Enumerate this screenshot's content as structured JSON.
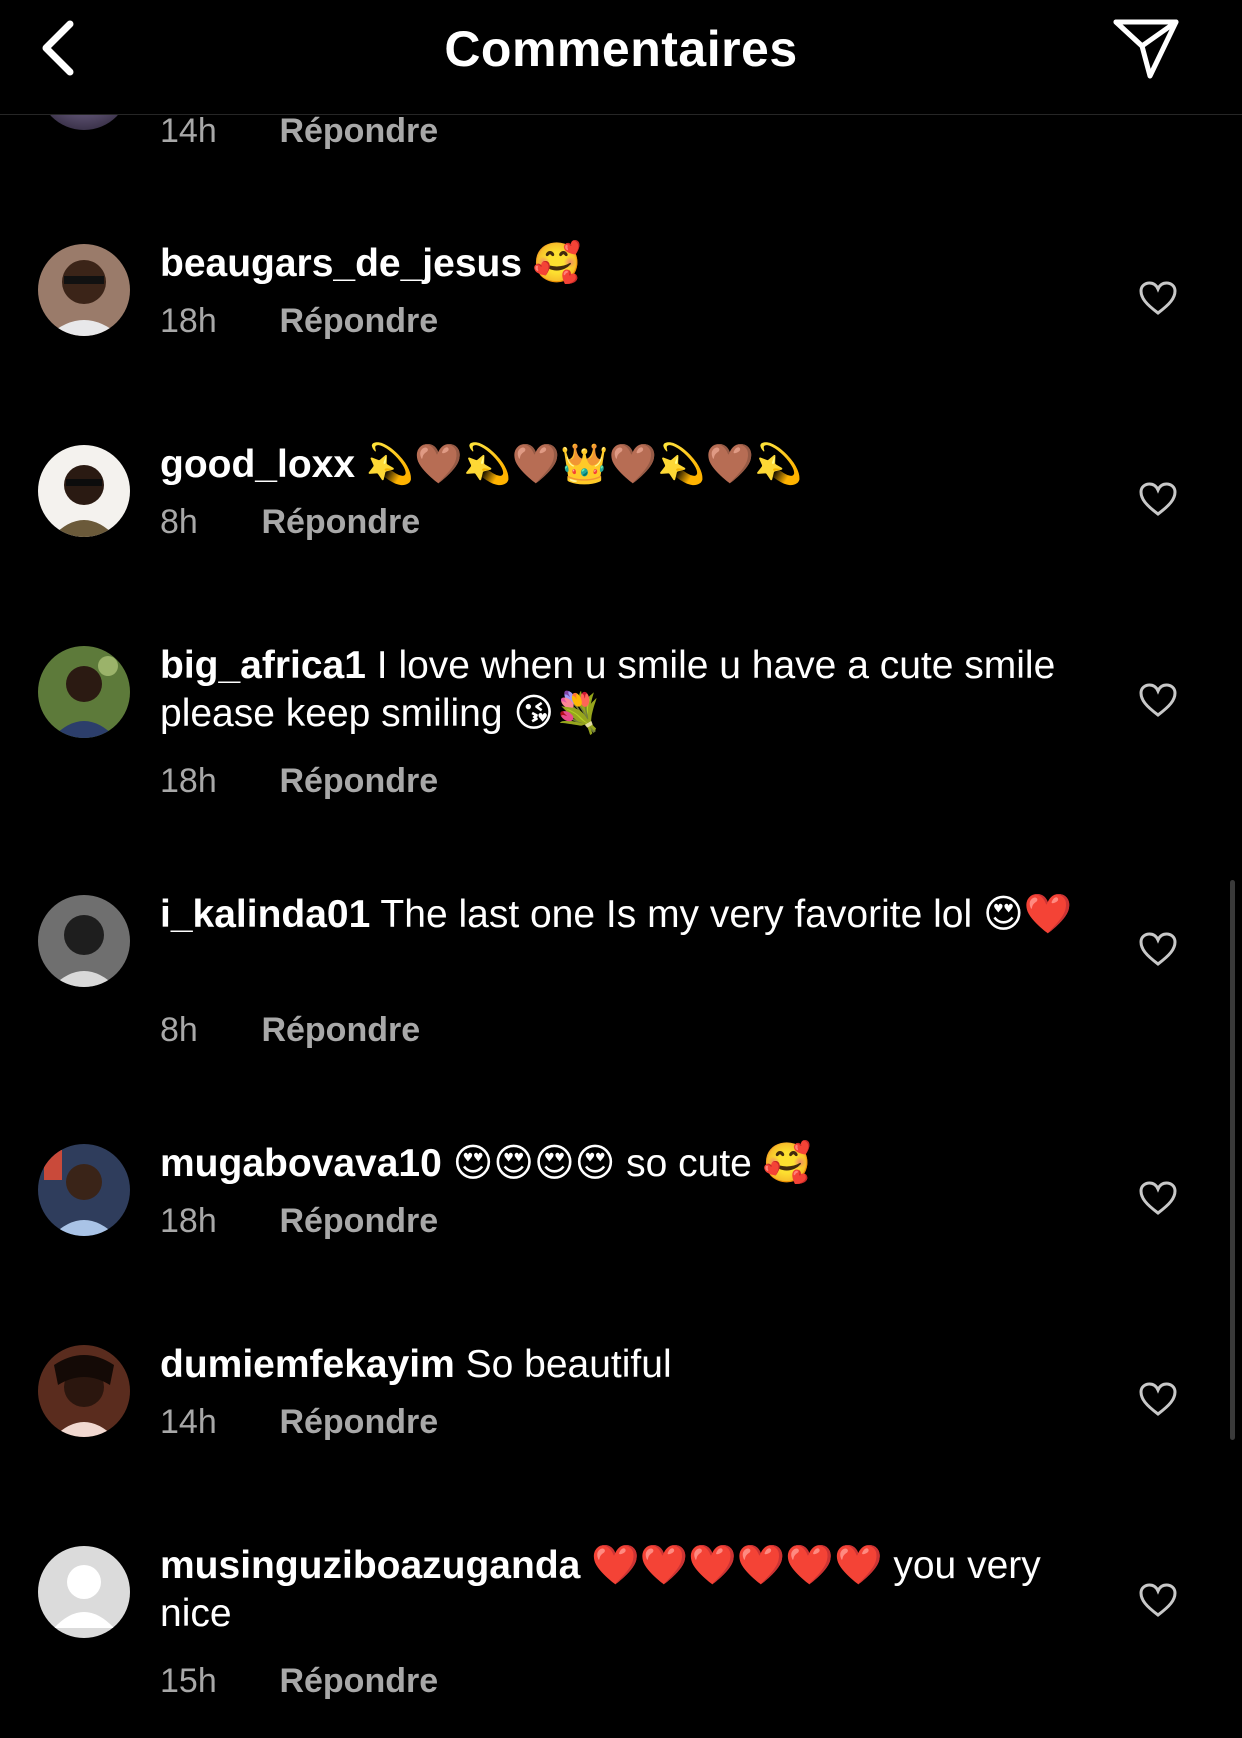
{
  "header": {
    "title": "Commentaires",
    "back_icon": "chevron-left-icon",
    "send_icon": "paper-plane-icon"
  },
  "partial": {
    "time": "14h",
    "reply": "Répondre"
  },
  "comments": [
    {
      "username": "beaugars_de_jesus",
      "text": " 🥰",
      "time": "18h",
      "reply": "Répondre"
    },
    {
      "username": "good_loxx",
      "text": " 💫🤎💫🤎👑🤎💫🤎💫",
      "time": "8h",
      "reply": "Répondre"
    },
    {
      "username": "big_africa1",
      "text": " I love when u smile u have a cute smile please keep smiling 😘💐",
      "time": "18h",
      "reply": "Répondre"
    },
    {
      "username": "i_kalinda01",
      "text": " The last one Is my very favorite lol 😍❤️",
      "time": "8h",
      "reply": "Répondre"
    },
    {
      "username": "mugabovava10",
      "text": " 😍😍😍😍 so cute 🥰",
      "time": "18h",
      "reply": "Répondre"
    },
    {
      "username": "dumiemfekayim",
      "text": " So beautiful",
      "time": "14h",
      "reply": "Répondre"
    },
    {
      "username": "musinguziboazuganda",
      "text": " ❤️❤️❤️❤️❤️❤️ you very nice",
      "time": "15h",
      "reply": "Répondre"
    }
  ],
  "colors": {
    "background": "#000000",
    "text": "#ffffff",
    "secondary": "#a8a8a8"
  }
}
